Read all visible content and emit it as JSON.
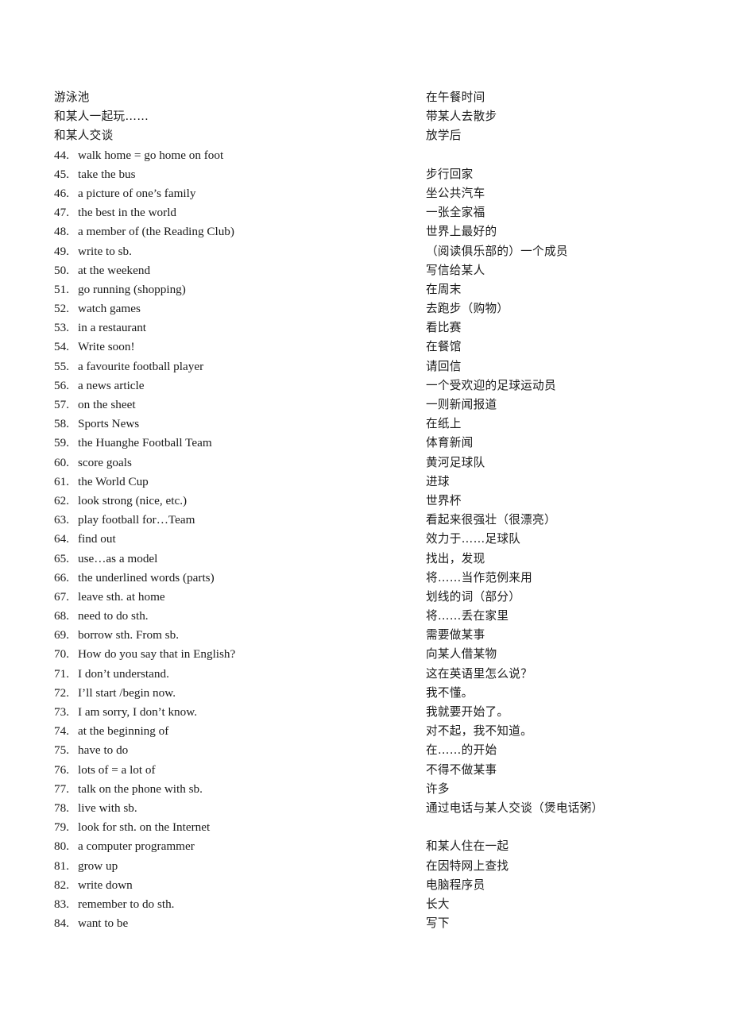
{
  "document": {
    "type": "vocabulary-phrase-list",
    "left_column_heading_lines": [
      "游泳池",
      "和某人一起玩……",
      "和某人交谈"
    ],
    "entries": [
      {
        "number": "44.",
        "english": "walk home = go home on foot"
      },
      {
        "number": "45.",
        "english": "take the bus"
      },
      {
        "number": "46.",
        "english": "a picture of one’s family"
      },
      {
        "number": "47.",
        "english": "the best in the world"
      },
      {
        "number": "48.",
        "english": "a member of (the Reading Club)"
      },
      {
        "number": "49.",
        "english": "write to sb."
      },
      {
        "number": "50.",
        "english": "at the weekend"
      },
      {
        "number": "51.",
        "english": "go running (shopping)"
      },
      {
        "number": "52.",
        "english": "watch games"
      },
      {
        "number": "53.",
        "english": "in a restaurant"
      },
      {
        "number": "54.",
        "english": "Write soon!"
      },
      {
        "number": "55.",
        "english": "a favourite football player"
      },
      {
        "number": "56.",
        "english": "a news article"
      },
      {
        "number": "57.",
        "english": "on the sheet"
      },
      {
        "number": "58.",
        "english": "Sports News"
      },
      {
        "number": "59.",
        "english": "the Huanghe Football Team"
      },
      {
        "number": "60.",
        "english": "score goals"
      },
      {
        "number": "61.",
        "english": "the World Cup"
      },
      {
        "number": "62.",
        "english": "look strong (nice, etc.)"
      },
      {
        "number": "63.",
        "english": "play football for…Team"
      },
      {
        "number": "64.",
        "english": "find out"
      },
      {
        "number": "65.",
        "english": "use…as a model"
      },
      {
        "number": "66.",
        "english": "the underlined words (parts)"
      },
      {
        "number": "67.",
        "english": "leave sth. at home"
      },
      {
        "number": "68.",
        "english": "need to do sth."
      },
      {
        "number": "69.",
        "english": "borrow sth. From sb."
      },
      {
        "number": "70.",
        "english": "How do you say that in English?"
      },
      {
        "number": "71.",
        "english": "I don’t understand."
      },
      {
        "number": "72.",
        "english": "I’ll start /begin now."
      },
      {
        "number": "73.",
        "english": "I am sorry, I don’t know."
      },
      {
        "number": "74.",
        "english": "at the beginning of"
      },
      {
        "number": "75.",
        "english": "have to do"
      },
      {
        "number": "76.",
        "english": "lots of = a lot of"
      },
      {
        "number": "77.",
        "english": "talk on the phone with sb."
      },
      {
        "number": "78.",
        "english": "live with sb."
      },
      {
        "number": "79.",
        "english": "look for sth. on the Internet"
      },
      {
        "number": "80.",
        "english": "a computer programmer"
      },
      {
        "number": "81.",
        "english": "grow up"
      },
      {
        "number": "82.",
        "english": "write down"
      },
      {
        "number": "83.",
        "english": "remember to do sth."
      },
      {
        "number": "84.",
        "english": "want to be"
      }
    ],
    "chinese_lines": [
      "在午餐时间",
      "带某人去散步",
      "放学后",
      "",
      "步行回家",
      "坐公共汽车",
      "一张全家福",
      "世界上最好的",
      "（阅读俱乐部的）一个成员",
      "写信给某人",
      "在周末",
      "去跑步（购物）",
      "看比赛",
      "在餐馆",
      "请回信",
      "一个受欢迎的足球运动员",
      "一则新闻报道",
      "在纸上",
      "体育新闻",
      "黄河足球队",
      "进球",
      "世界杯",
      "看起来很强壮（很漂亮）",
      "效力于……足球队",
      "找出，发现",
      "将……当作范例来用",
      "划线的词（部分）",
      "将……丢在家里",
      "需要做某事",
      "向某人借某物",
      "这在英语里怎么说？",
      "我不懂。",
      "我就要开始了。",
      "对不起，我不知道。",
      "在……的开始",
      "不得不做某事",
      "许多",
      "通过电话与某人交谈（煲电话粥）",
      "",
      "和某人住在一起",
      "在因特网上查找",
      "电脑程序员",
      "长大",
      "写下"
    ]
  }
}
